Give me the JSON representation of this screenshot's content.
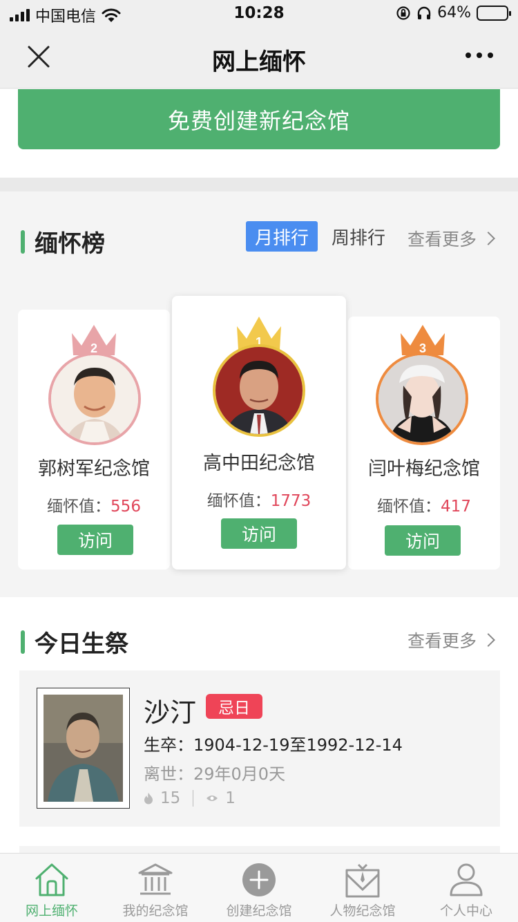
{
  "status_bar": {
    "carrier": "中国电信",
    "time": "10:28",
    "battery_pct_text": "64%",
    "battery_level": 0.64
  },
  "nav": {
    "title": "网上缅怀",
    "close_icon": "close-icon",
    "more_icon": "more-dots-icon"
  },
  "create": {
    "label": "免费创建新纪念馆"
  },
  "ranking": {
    "title": "缅怀榜",
    "tab_month": "月排行",
    "tab_week": "周排行",
    "see_more": "查看更多",
    "value_label": "缅怀值：",
    "visit_label": "访问",
    "items": [
      {
        "rank": "2",
        "name": "郭树军纪念馆",
        "value": "556",
        "crown_color": "#e8a4a8"
      },
      {
        "rank": "1",
        "name": "高中田纪念馆",
        "value": "1773",
        "crown_color": "#f2c94c"
      },
      {
        "rank": "3",
        "name": "闫叶梅纪念馆",
        "value": "417",
        "crown_color": "#ee8b3f"
      }
    ]
  },
  "today": {
    "title": "今日生祭",
    "see_more": "查看更多",
    "person": {
      "name": "沙汀",
      "badge": "忌日",
      "life": "生卒：1904-12-19至1992-12-14",
      "passed": "离世：29年0月0天",
      "flames": "15",
      "views": "1"
    }
  },
  "tabs": [
    {
      "label": "网上缅怀",
      "icon": "home-icon",
      "active": true
    },
    {
      "label": "我的纪念馆",
      "icon": "memorial-hall-icon",
      "active": false
    },
    {
      "label": "创建纪念馆",
      "icon": "add-circle-icon",
      "active": false
    },
    {
      "label": "人物纪念馆",
      "icon": "person-memorial-icon",
      "active": false
    },
    {
      "label": "个人中心",
      "icon": "user-icon",
      "active": false
    }
  ],
  "colors": {
    "brand_green": "#4fb070",
    "tab_blue": "#4a8df0",
    "value_red": "#e0465a",
    "badge_red": "#ef4457"
  }
}
